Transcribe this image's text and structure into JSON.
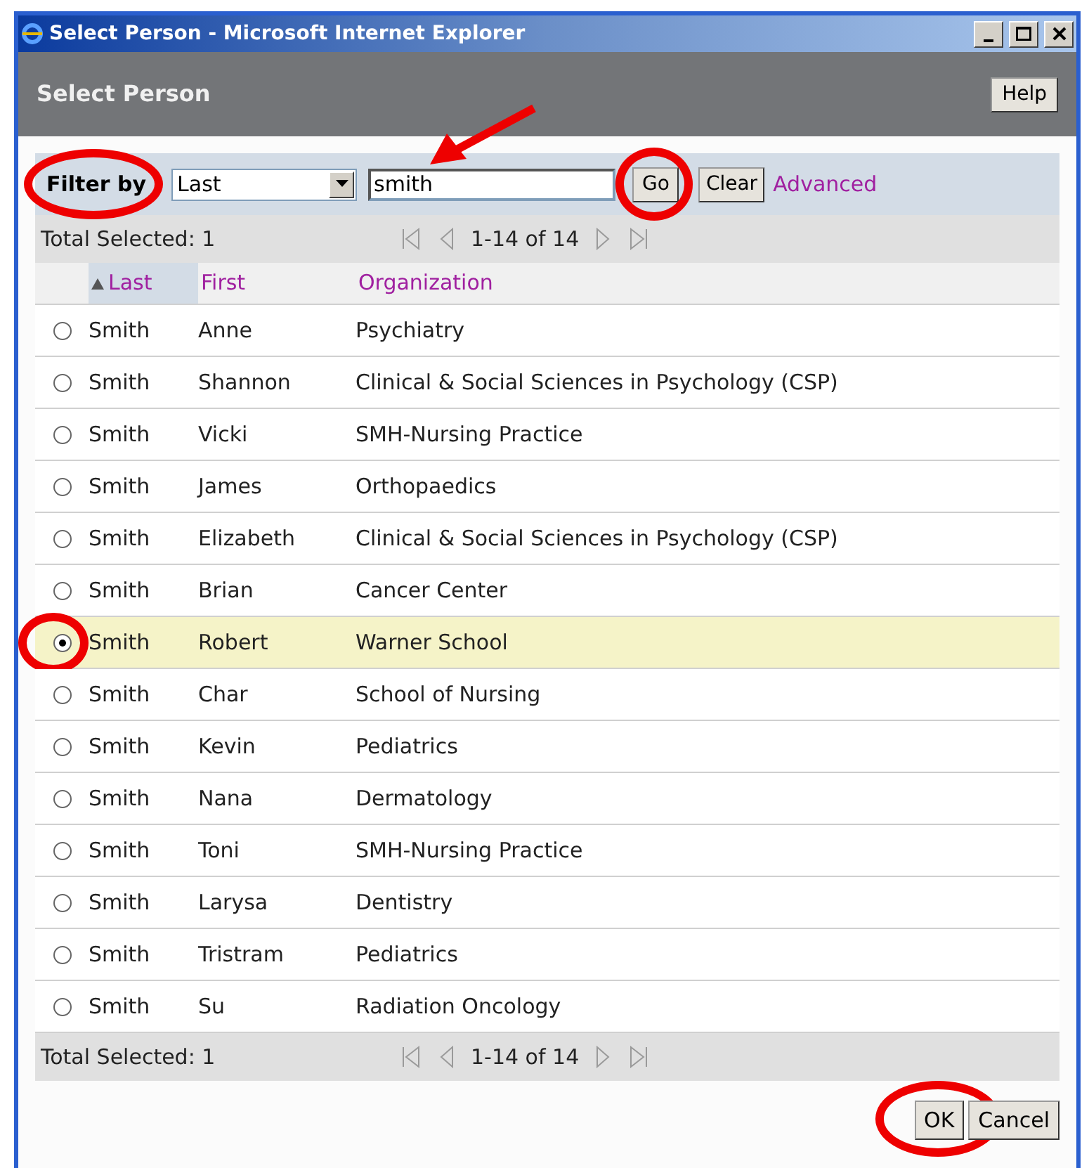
{
  "window": {
    "title": "Select Person - Microsoft Internet Explorer"
  },
  "header": {
    "title": "Select Person",
    "help_button": "Help"
  },
  "filter": {
    "label": "Filter by",
    "label_circled": true,
    "field": "Last",
    "search": "smith",
    "search_arrow": true,
    "go": "Go",
    "go_circled": true,
    "clear": "Clear",
    "advanced": "Advanced"
  },
  "pager_top": {
    "total": "Total Selected: 1",
    "range": "1-14 of 14"
  },
  "columns": [
    {
      "label": "Last",
      "sorted": true
    },
    {
      "label": "First",
      "sorted": false
    },
    {
      "label": "Organization",
      "sorted": false
    }
  ],
  "rows": [
    {
      "last": "Smith",
      "first": "Anne",
      "org": "Psychiatry",
      "selected": false
    },
    {
      "last": "Smith",
      "first": "Shannon",
      "org": "Clinical & Social Sciences in Psychology (CSP)",
      "selected": false
    },
    {
      "last": "Smith",
      "first": "Vicki",
      "org": "SMH-Nursing Practice",
      "selected": false
    },
    {
      "last": "Smith",
      "first": "James",
      "org": "Orthopaedics",
      "selected": false
    },
    {
      "last": "Smith",
      "first": "Elizabeth",
      "org": "Clinical & Social Sciences in Psychology (CSP)",
      "selected": false
    },
    {
      "last": "Smith",
      "first": "Brian",
      "org": "Cancer Center",
      "selected": false
    },
    {
      "last": "Smith",
      "first": "Robert",
      "org": "Warner School",
      "selected": true,
      "circled": true
    },
    {
      "last": "Smith",
      "first": "Char",
      "org": "School of Nursing",
      "selected": false
    },
    {
      "last": "Smith",
      "first": "Kevin",
      "org": "Pediatrics",
      "selected": false
    },
    {
      "last": "Smith",
      "first": "Nana",
      "org": "Dermatology",
      "selected": false
    },
    {
      "last": "Smith",
      "first": "Toni",
      "org": "SMH-Nursing Practice",
      "selected": false
    },
    {
      "last": "Smith",
      "first": "Larysa",
      "org": "Dentistry",
      "selected": false
    },
    {
      "last": "Smith",
      "first": "Tristram",
      "org": "Pediatrics",
      "selected": false
    },
    {
      "last": "Smith",
      "first": "Su",
      "org": "Radiation Oncology",
      "selected": false
    }
  ],
  "pager_bottom": {
    "total": "Total Selected: 1",
    "range": "1-14 of 14"
  },
  "buttons": [
    {
      "label": "OK",
      "circled": true
    },
    {
      "label": "Cancel",
      "circled": false
    }
  ]
}
